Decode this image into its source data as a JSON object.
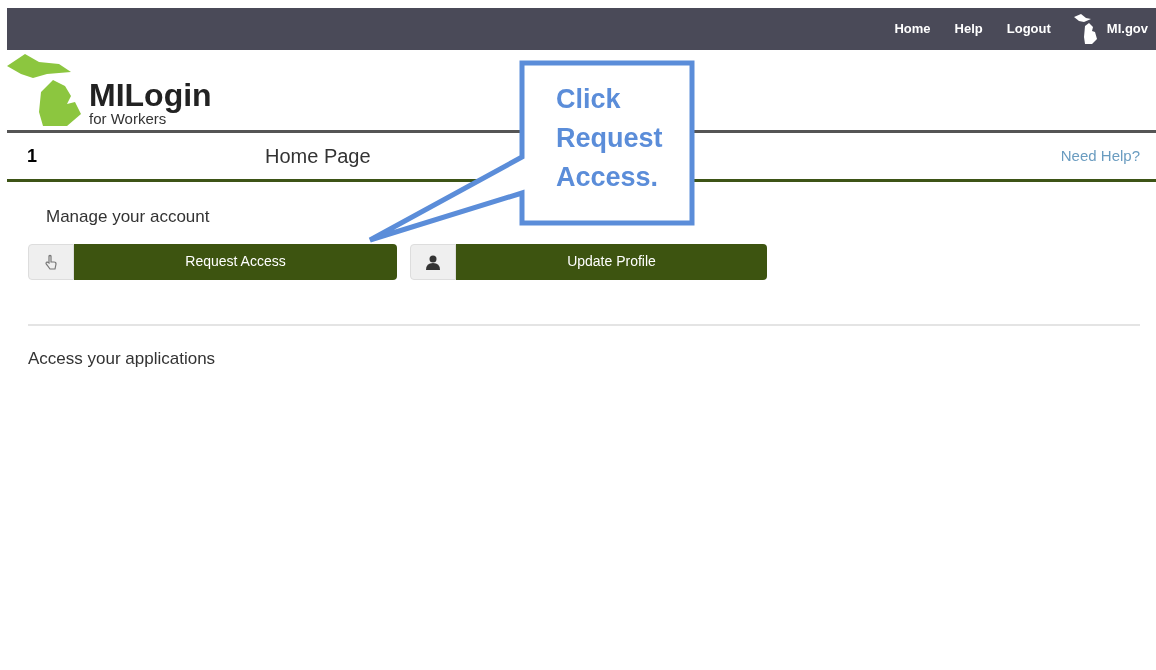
{
  "top_nav": {
    "links": [
      "Home",
      "Help",
      "Logout"
    ],
    "state_link": "MI.gov"
  },
  "logo": {
    "title": "MILogin",
    "subtitle": "for Workers"
  },
  "page_bar": {
    "marker": "1",
    "title": "Home Page",
    "help_link": "Need Help?"
  },
  "manage": {
    "heading": "Manage your account",
    "buttons": [
      {
        "label": "Request Access",
        "kind": "hand"
      },
      {
        "label": "Update Profile",
        "kind": "person"
      }
    ]
  },
  "applications": {
    "heading": "Access your applications"
  },
  "callout": {
    "text": "Click Request Access."
  }
}
